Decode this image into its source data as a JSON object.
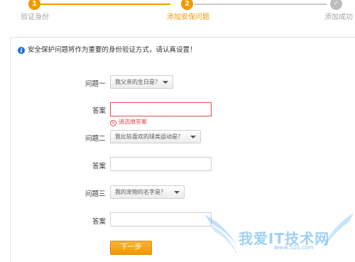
{
  "progress": {
    "steps": [
      {
        "number": "1",
        "label": "验证身份",
        "state": "done"
      },
      {
        "number": "2",
        "label": "添加安保问题",
        "state": "current"
      },
      {
        "number": "✓",
        "label": "添加成功",
        "state": "pending"
      }
    ],
    "colors": {
      "active": "#f39800",
      "inactive": "#bdbdbd"
    }
  },
  "notice": {
    "icon": "info-icon",
    "text": "安全保护问题将作为重要的身份验证方式，请认真设置！"
  },
  "form": {
    "q1": {
      "label": "问题一",
      "selected": "我父亲的生日是？"
    },
    "a1": {
      "label": "答案",
      "value": "",
      "error": "请选填答案"
    },
    "q2": {
      "label": "问题二",
      "selected": "我比较喜欢的球类运动是？"
    },
    "a2": {
      "label": "答案",
      "value": ""
    },
    "q3": {
      "label": "问题三",
      "selected": "我的宠物的名字是？"
    },
    "a3": {
      "label": "答案",
      "value": ""
    },
    "next_label": "下一步"
  },
  "watermark": {
    "text": "我爱IT技术网",
    "url": "www.52ij.com"
  }
}
